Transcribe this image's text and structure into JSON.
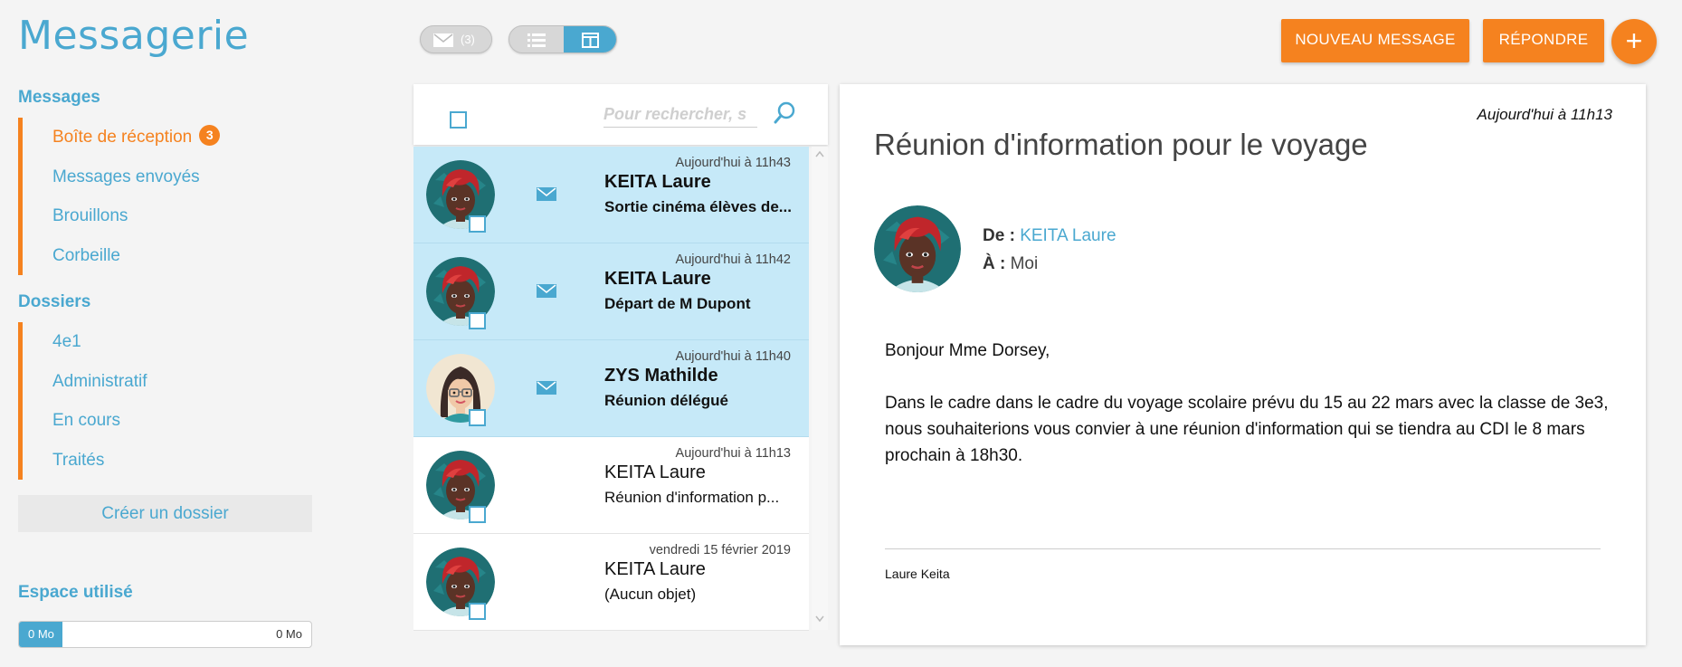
{
  "app": {
    "title": "Messagerie"
  },
  "sidebar": {
    "messages_title": "Messages",
    "messages": [
      {
        "label": "Boîte de réception",
        "badge": "3"
      },
      {
        "label": "Messages envoyés"
      },
      {
        "label": "Brouillons"
      },
      {
        "label": "Corbeille"
      }
    ],
    "folders_title": "Dossiers",
    "folders": [
      {
        "label": "4e1"
      },
      {
        "label": "Administratif"
      },
      {
        "label": "En cours"
      },
      {
        "label": "Traités"
      }
    ],
    "create_folder": "Créer un dossier",
    "storage_title": "Espace utilisé",
    "storage_used": "0 Mo",
    "storage_max": "0 Mo",
    "storage_fraction": 0.15
  },
  "toolbar": {
    "unread_count": "(3)",
    "new_message": "NOUVEAU MESSAGE",
    "reply": "RÉPONDRE",
    "fab": "+"
  },
  "search": {
    "placeholder": "Pour rechercher, s"
  },
  "messages": [
    {
      "date": "Aujourd'hui à 11h43",
      "sender": "KEITA Laure",
      "subject": "Sortie cinéma élèves de...",
      "unread": true,
      "avatar": "red-hair"
    },
    {
      "date": "Aujourd'hui à 11h42",
      "sender": "KEITA Laure",
      "subject": "Départ de M Dupont",
      "unread": true,
      "avatar": "red-hair"
    },
    {
      "date": "Aujourd'hui à 11h40",
      "sender": "ZYS Mathilde",
      "subject": "Réunion délégué",
      "unread": true,
      "avatar": "glasses"
    },
    {
      "date": "Aujourd'hui à 11h13",
      "sender": "KEITA Laure",
      "subject": "Réunion d'information p...",
      "unread": false,
      "avatar": "red-hair"
    },
    {
      "date": "vendredi 15 février 2019",
      "sender": "KEITA Laure",
      "subject": "(Aucun objet)",
      "unread": false,
      "avatar": "red-hair"
    }
  ],
  "reader": {
    "date": "Aujourd'hui à 11h13",
    "subject": "Réunion d'information pour le voyage",
    "from_label": "De :",
    "from": "KEITA Laure",
    "to_label": "À :",
    "to": "Moi",
    "greeting": "Bonjour Mme Dorsey,",
    "body": "Dans le cadre dans le cadre du voyage scolaire prévu du 15 au 22 mars avec la classe de 3e3, nous souhaiterions vous convier à une réunion d'information qui se tiendra au CDI le 8 mars prochain à 18h30.",
    "signature": "Laure Keita"
  },
  "colors": {
    "accent": "#4aa8d0",
    "orange": "#f5821f",
    "unread_bg": "#c6e9f8"
  }
}
